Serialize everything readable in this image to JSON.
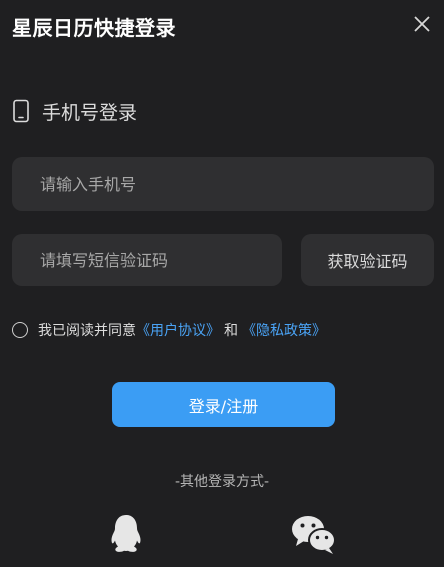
{
  "dialog": {
    "title": "星辰日历快捷登录"
  },
  "section": {
    "title": "手机号登录"
  },
  "phone": {
    "placeholder": "请输入手机号",
    "value": ""
  },
  "code": {
    "placeholder": "请填写短信验证码",
    "value": "",
    "button_label": "获取验证码"
  },
  "agreement": {
    "prefix": "我已阅读并同意",
    "user_agreement": "《用户协议》",
    "conjunction": "和",
    "privacy_policy": "《隐私政策》",
    "checked": false
  },
  "login_button": {
    "label": "登录/注册"
  },
  "other_login": {
    "label": "-其他登录方式-",
    "methods": [
      "qq-icon",
      "wechat-icon"
    ]
  },
  "colors": {
    "background": "#1f1f21",
    "input_bg": "#2f2f31",
    "accent": "#3b9df4",
    "link": "#4aa3f5"
  }
}
